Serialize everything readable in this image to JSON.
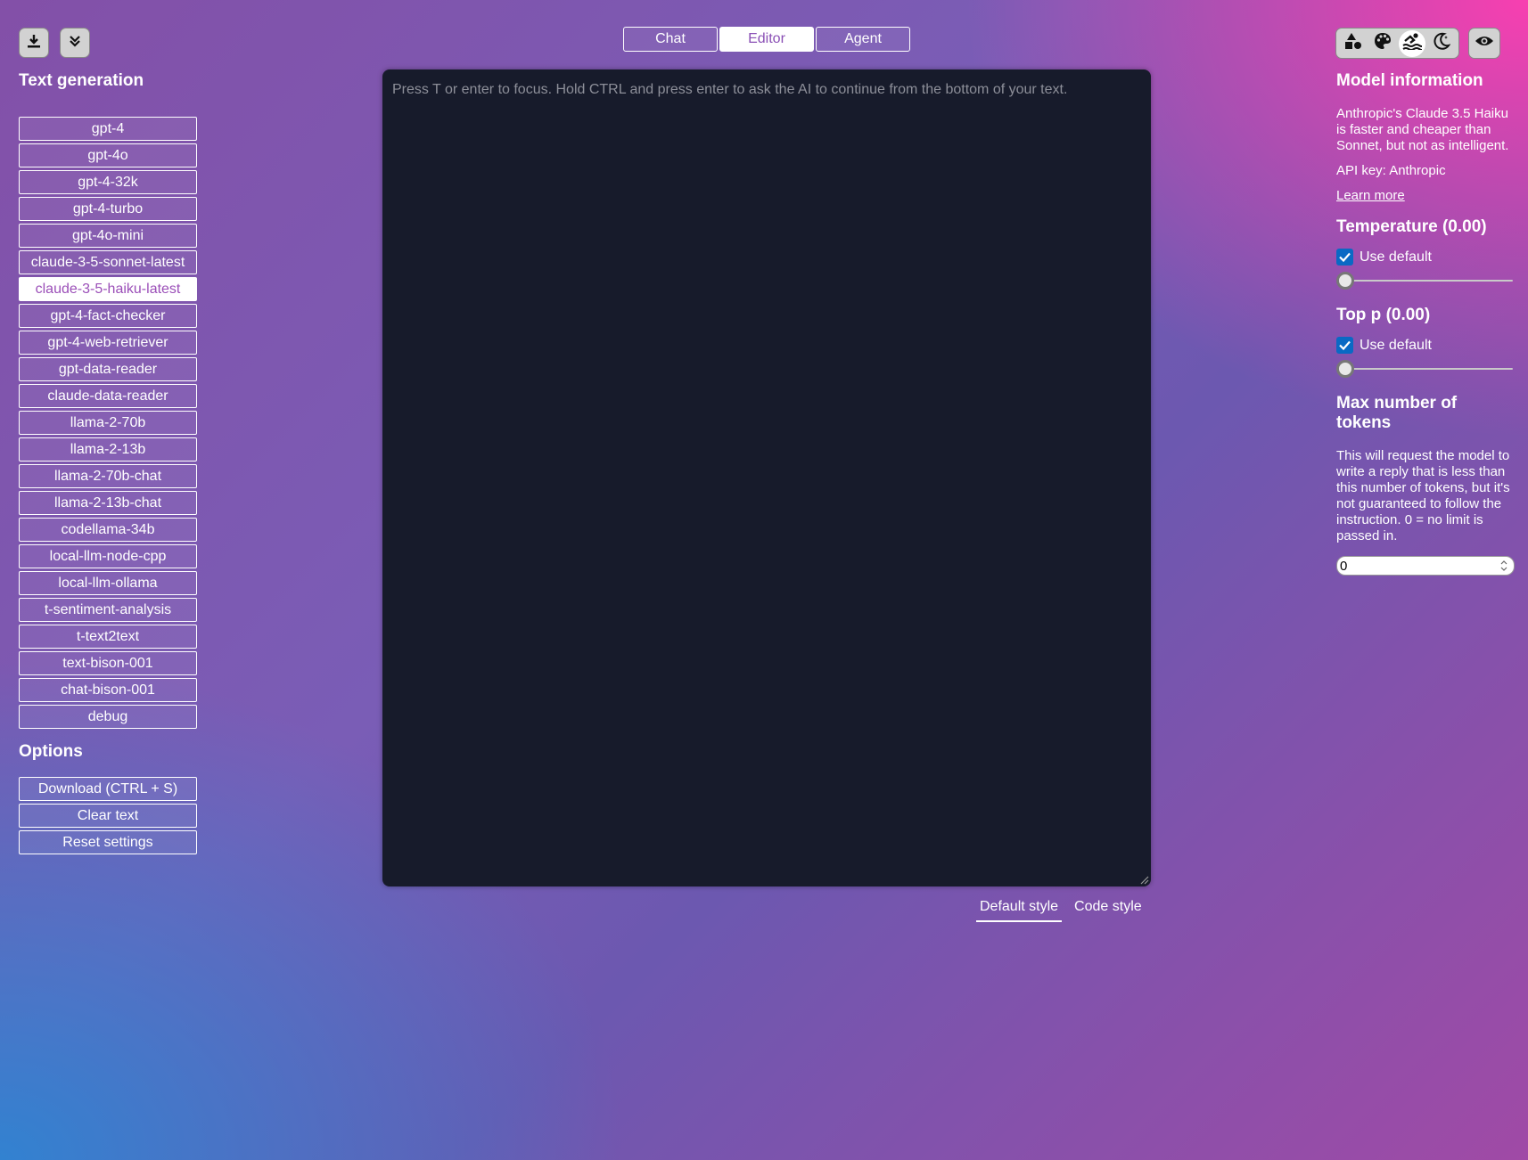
{
  "mode_tabs": [
    {
      "label": "Chat",
      "active": false
    },
    {
      "label": "Editor",
      "active": true
    },
    {
      "label": "Agent",
      "active": false
    }
  ],
  "left": {
    "title": "Text generation",
    "models": [
      "gpt-4",
      "gpt-4o",
      "gpt-4-32k",
      "gpt-4-turbo",
      "gpt-4o-mini",
      "claude-3-5-sonnet-latest",
      "claude-3-5-haiku-latest",
      "gpt-4-fact-checker",
      "gpt-4-web-retriever",
      "gpt-data-reader",
      "claude-data-reader",
      "llama-2-70b",
      "llama-2-13b",
      "llama-2-70b-chat",
      "llama-2-13b-chat",
      "codellama-34b",
      "local-llm-node-cpp",
      "local-llm-ollama",
      "t-sentiment-analysis",
      "t-text2text",
      "text-bison-001",
      "chat-bison-001",
      "debug"
    ],
    "selected_model": "claude-3-5-haiku-latest",
    "options_title": "Options",
    "options": [
      "Download (CTRL + S)",
      "Clear text",
      "Reset settings"
    ]
  },
  "editor": {
    "placeholder": "Press T or enter to focus. Hold CTRL and press enter to ask the AI to continue from the bottom of your text."
  },
  "style_tabs": [
    {
      "label": "Default style",
      "active": true
    },
    {
      "label": "Code style",
      "active": false
    }
  ],
  "right": {
    "model_info_title": "Model information",
    "model_description": "Anthropic's Claude 3.5 Haiku is faster and cheaper than Sonnet, but not as intelligent.",
    "api_key": "API key: Anthropic",
    "learn_more": "Learn more",
    "temperature_title": "Temperature (0.00)",
    "temperature_use_default": "Use default",
    "temperature_value": 0,
    "top_p_title": "Top p (0.00)",
    "top_p_use_default": "Use default",
    "top_p_value": 0,
    "max_tokens_title": "Max number of tokens",
    "max_tokens_description": "This will request the model to write a reply that is less than this number of tokens, but it's not guaranteed to follow the instruction. 0 = no limit is passed in.",
    "max_tokens_value": "0"
  },
  "toolbar": {
    "left_icons": [
      "download-icon",
      "double-chevron-down-icon"
    ],
    "theme_icons": [
      "shapes-icon",
      "palette-icon",
      "swimmer-icon",
      "moon-icon"
    ],
    "active_theme": "swimmer-icon",
    "eye_icon": "eye-icon"
  },
  "colors": {
    "editor_bg": "#171b2b",
    "accent_purple": "#9b4fb8",
    "checkbox_blue": "#0a69c4"
  }
}
